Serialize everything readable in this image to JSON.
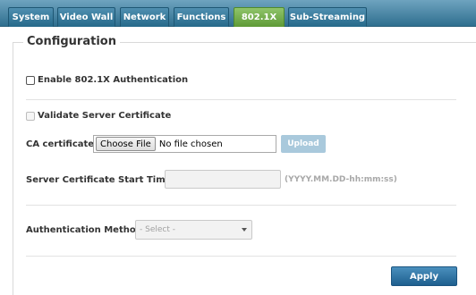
{
  "tabs": [
    {
      "label": "System",
      "active": false
    },
    {
      "label": "Video Wall",
      "active": false
    },
    {
      "label": "Network",
      "active": false
    },
    {
      "label": "Functions",
      "active": false
    },
    {
      "label": "802.1X",
      "active": true
    },
    {
      "label": "Sub-Streaming",
      "active": false
    }
  ],
  "section": {
    "title": "Configuration"
  },
  "enable_8021x": {
    "label": "Enable 802.1X Authentication",
    "checked": false
  },
  "validate_cert": {
    "label": "Validate Server Certificate",
    "checked": false,
    "disabled": true
  },
  "ca_certificate": {
    "label": "CA certificate:",
    "choose_label": "Choose File",
    "file_status": "No file chosen",
    "upload_label": "Upload"
  },
  "start_time": {
    "label": "Server Certificate Start Time:",
    "value": "",
    "hint": "(YYYY.MM.DD-hh:mm:ss)"
  },
  "auth_method": {
    "label": "Authentication Method:",
    "selected": "- Select -"
  },
  "apply_label": "Apply",
  "colors": {
    "tab_bar": "#2f6f8f",
    "active_tab": "#6fa947",
    "apply_button": "#2a6fa0",
    "upload_button_disabled": "#a9c9dc"
  }
}
